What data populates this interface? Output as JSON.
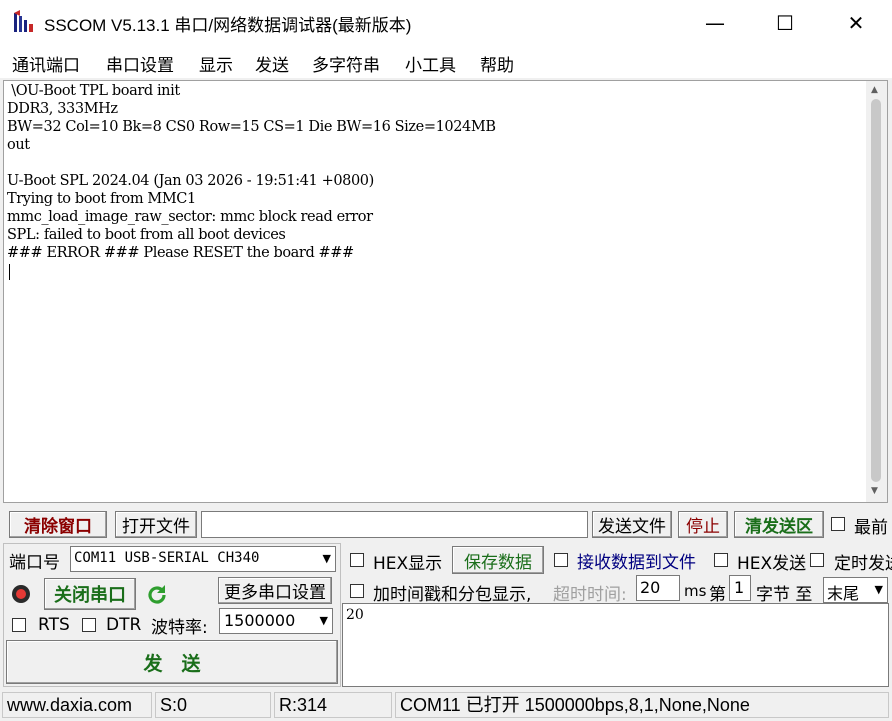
{
  "window": {
    "title": "SSCOM V5.13.1 串口/网络数据调试器(最新版本)",
    "minimize_glyph": "—",
    "maximize_glyph": "☐",
    "close_glyph": "✕"
  },
  "menu": [
    "通讯端口",
    "串口设置",
    "显示",
    "发送",
    "多字符串",
    "小工具",
    "帮助"
  ],
  "terminal": {
    "lines": [
      " \\OU-Boot TPL board init",
      "DDR3, 333MHz",
      "BW=32 Col=10 Bk=8 CS0 Row=15 CS=1 Die BW=16 Size=1024MB",
      "out",
      "",
      "U-Boot SPL 2024.04 (Jan 03 2026 - 19:51:41 +0800)",
      "Trying to boot from MMC1",
      "mmc_load_image_raw_sector: mmc block read error",
      "SPL: failed to boot from all boot devices",
      "### ERROR ### Please RESET the board ###"
    ]
  },
  "file_row": {
    "clear_window": "清除窗口",
    "open_file": "打开文件",
    "file_path": "",
    "send_file": "发送文件",
    "stop": "停止",
    "clear_send": "清发送区",
    "topmost": "最前"
  },
  "port": {
    "port_label": "端口号",
    "port_value": "COM11 USB-SERIAL CH340",
    "close_port": "关闭串口",
    "more_settings": "更多串口设置",
    "rts": "RTS",
    "dtr": "DTR",
    "baud_label": "波特率:",
    "baud_value": "1500000",
    "send_button": "发　送"
  },
  "options": {
    "hex_display": "HEX显示",
    "save_data": "保存数据",
    "recv_to_file": "接收数据到文件",
    "hex_send": "HEX发送",
    "timed_send": "定时发送",
    "timestamp": "加时间戳和分包显示,",
    "timeout_label": "超时时间:",
    "timeout_value": "20",
    "ms": "ms",
    "nth_prefix": "第",
    "nth_value": "1",
    "byte_to": "字节 至",
    "end_value": "末尾"
  },
  "send_area": {
    "text": "20"
  },
  "status": {
    "website": "www.daxia.com",
    "sent": "S:0",
    "received": "R:314",
    "port_status": "COM11 已打开  1500000bps,8,1,None,None"
  },
  "colors": {
    "accent_red": "#8b0000",
    "accent_green": "#1a6e1a",
    "blue_link": "#000080"
  }
}
